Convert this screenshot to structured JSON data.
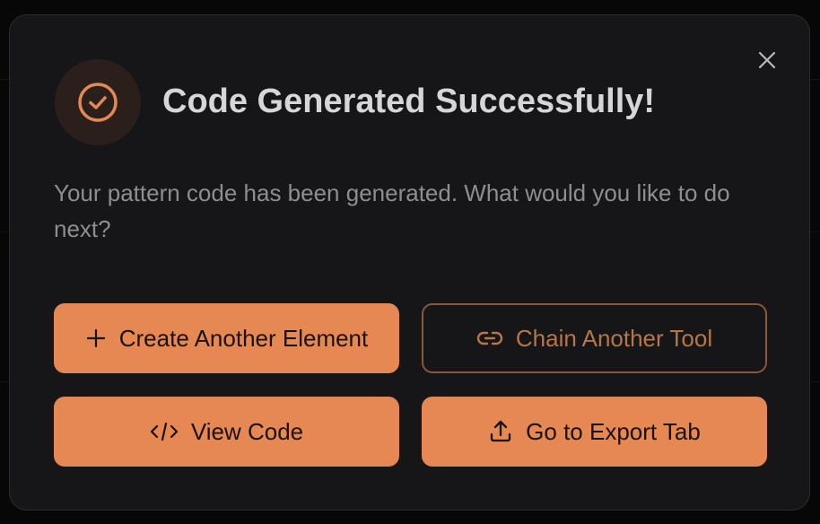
{
  "dialog": {
    "title": "Code Generated Successfully!",
    "description": "Your pattern code has been generated. What would you like to do next?",
    "icon": "check-circle-icon",
    "close_icon": "close-icon"
  },
  "actions": {
    "create_label": "Create Another Element",
    "create_icon": "plus-icon",
    "chain_label": "Chain Another Tool",
    "chain_icon": "link-icon",
    "view_label": "View Code",
    "view_icon": "code-icon",
    "export_label": "Go to Export Tab",
    "export_icon": "upload-icon"
  },
  "colors": {
    "accent": "#e58853",
    "accent_outline": "#8c5737",
    "background": "#161618",
    "title": "#d6d6d6",
    "description": "#8e8e8f"
  }
}
